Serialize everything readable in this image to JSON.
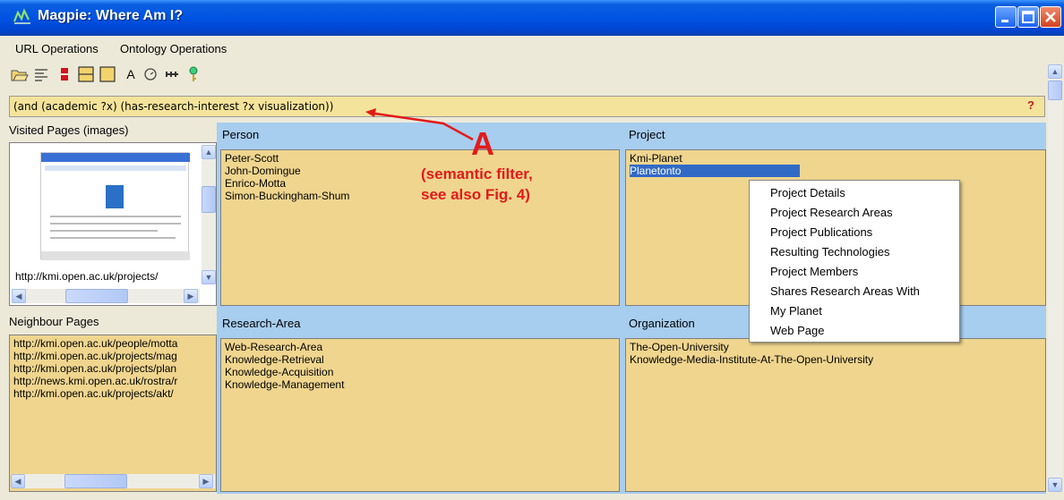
{
  "window": {
    "title": "Magpie: Where Am I?"
  },
  "menu": {
    "items": [
      "URL Operations",
      "Ontology Operations"
    ]
  },
  "toolbar": {
    "text_tool_label": "A"
  },
  "query": {
    "value": "(and (academic ?x) (has-research-interest ?x visualization))",
    "help_label": "?"
  },
  "visited": {
    "title": "Visited Pages (images)",
    "url": "http://kmi.open.ac.uk/projects/"
  },
  "neighbour": {
    "title": "Neighbour Pages",
    "items": [
      "http://kmi.open.ac.uk/people/motta",
      "http://kmi.open.ac.uk/projects/mag",
      "http://kmi.open.ac.uk/projects/plan",
      "http://news.kmi.open.ac.uk/rostra/r",
      "http://kmi.open.ac.uk/projects/akt/"
    ]
  },
  "person": {
    "title": "Person",
    "items": [
      "Peter-Scott",
      "John-Domingue",
      "Enrico-Motta",
      "Simon-Buckingham-Shum"
    ]
  },
  "project": {
    "title": "Project",
    "items": [
      "Kmi-Planet",
      "Planetonto"
    ],
    "selected_index": 1
  },
  "research_area": {
    "title": "Research-Area",
    "items": [
      "Web-Research-Area",
      "Knowledge-Retrieval",
      "Knowledge-Acquisition",
      "Knowledge-Management"
    ]
  },
  "organization": {
    "title": "Organization",
    "items": [
      "The-Open-University",
      "Knowledge-Media-Institute-At-The-Open-University"
    ]
  },
  "context_menu": {
    "items": [
      "Project Details",
      "Project Research Areas",
      "Project Publications",
      "Resulting Technologies",
      "Project Members",
      "Shares Research Areas With",
      "My Planet",
      "Web Page"
    ]
  },
  "annotation": {
    "letter": "A",
    "line1": "(semantic filter,",
    "line2": "see also Fig. 4)"
  },
  "colors": {
    "panel_header": "#a7cdef",
    "list_background": "#efd58e",
    "selection": "#316ac5",
    "annotation": "#e31a1a"
  },
  "icons": [
    "app-icon",
    "minimize-icon",
    "maximize-icon",
    "close-icon",
    "open-folder-icon",
    "align-text-icon",
    "red-block-icon",
    "split-frame-icon",
    "single-frame-icon",
    "text-icon",
    "clock-icon",
    "link-icon",
    "key-icon",
    "help-icon"
  ]
}
